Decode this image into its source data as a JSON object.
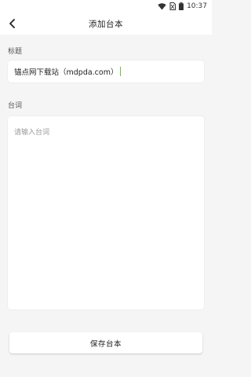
{
  "status_bar": {
    "time": "10:37",
    "icons": [
      "wifi-icon",
      "no-sim-icon",
      "battery-icon"
    ]
  },
  "app_bar": {
    "title": "添加台本",
    "back_icon": "chevron-left-icon"
  },
  "form": {
    "title_label": "标题",
    "title_value": "锚点网下载站（mdpda.com）",
    "lines_label": "台词",
    "lines_placeholder": "请输入台词"
  },
  "actions": {
    "save_label": "保存台本"
  },
  "colors": {
    "caret": "#6abf3c",
    "background": "#f5f5f5",
    "surface": "#ffffff"
  }
}
